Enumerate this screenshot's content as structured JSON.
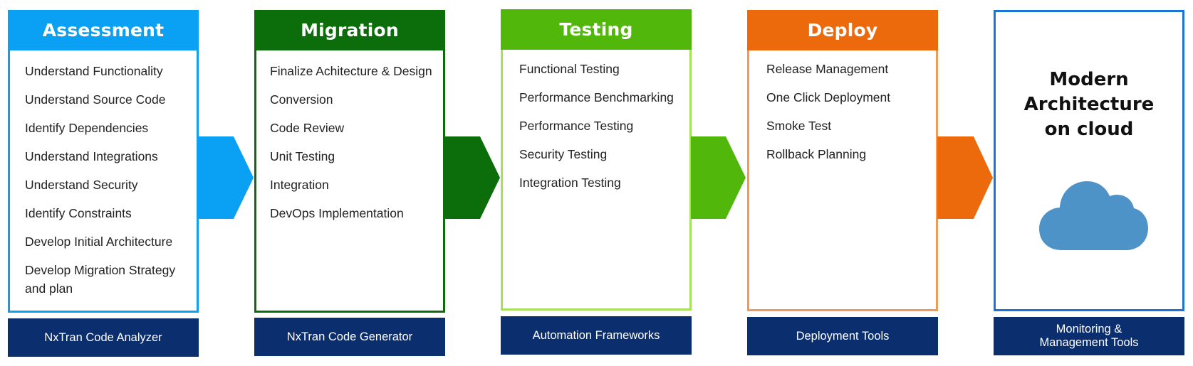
{
  "colors": {
    "assessment": "#0aa1f5",
    "migration": "#0b6e0b",
    "testing": "#52b70b",
    "testing_border": "#a8df5d",
    "deploy": "#ec6a0c",
    "deploy_border": "#ee9b57",
    "final_border": "#1a74d9",
    "tool_bar": "#0b2f6e",
    "cloud": "#4e93c8"
  },
  "stages": [
    {
      "title": "Assessment",
      "items": [
        "Understand Functionality",
        "Understand Source Code",
        "Identify Dependencies",
        "Understand Integrations",
        "Understand Security",
        "Identify Constraints",
        "Develop Initial Architecture",
        "Develop Migration Strategy and plan"
      ],
      "tool": "NxTran Code Analyzer"
    },
    {
      "title": "Migration",
      "items": [
        "Finalize Achitecture & Design",
        "Conversion",
        "Code Review",
        "Unit Testing",
        "Integration",
        "DevOps Implementation"
      ],
      "tool": "NxTran Code Generator"
    },
    {
      "title": "Testing",
      "items": [
        "Functional Testing",
        "Performance Benchmarking",
        "Performance Testing",
        "Security Testing",
        "Integration Testing"
      ],
      "tool": "Automation Frameworks"
    },
    {
      "title": "Deploy",
      "items": [
        "Release Management",
        "One Click Deployment",
        "Smoke Test",
        "Rollback Planning"
      ],
      "tool": "Deployment Tools"
    }
  ],
  "final": {
    "title_lines": [
      "Modern",
      "Architecture",
      "on cloud"
    ],
    "icon": "cloud-icon",
    "tool_lines": [
      "Monitoring &",
      "Management Tools"
    ]
  }
}
